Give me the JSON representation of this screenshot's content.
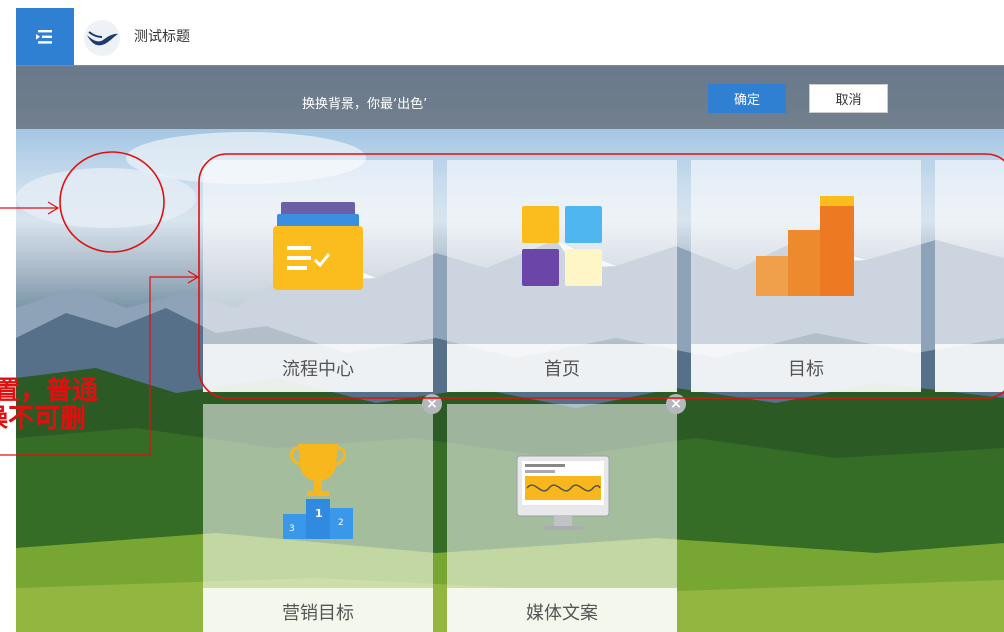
{
  "header": {
    "menu_icon": "menu-list-icon",
    "logo_icon": "bird-logo-icon",
    "title": "测试标题"
  },
  "notice": {
    "message": "换换背景，你最‘出色’",
    "confirm_label": "确定",
    "cancel_label": "取消"
  },
  "tiles": [
    {
      "label": "流程中心",
      "icon": "folder-process-icon"
    },
    {
      "label": "首页",
      "icon": "home-grid-icon"
    },
    {
      "label": "目标",
      "icon": "bar-chart-icon"
    },
    {
      "label": "",
      "icon": ""
    },
    {
      "label": "营销目标",
      "icon": "trophy-podium-icon"
    },
    {
      "label": "媒体文案",
      "icon": "monitor-wave-icon"
    }
  ],
  "annotation": {
    "line1": "置，普通",
    "line2": "操不可删"
  },
  "colors": {
    "accent": "#2f7fd3",
    "annotation_red": "#e01010"
  }
}
